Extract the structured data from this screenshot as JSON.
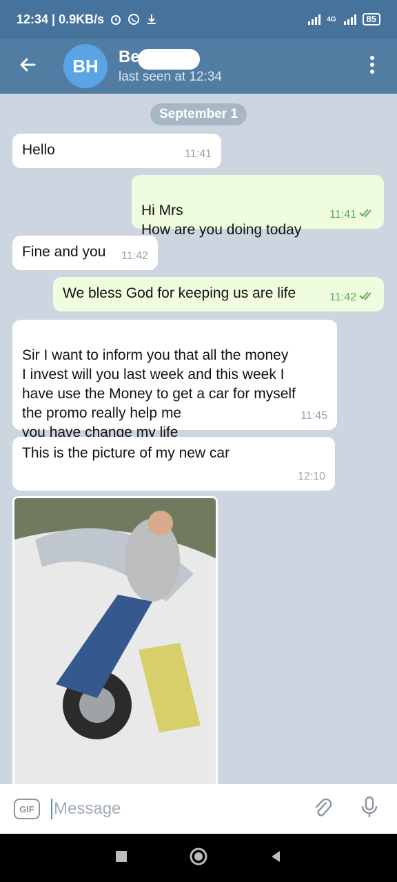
{
  "status_bar": {
    "time_speed": "12:34 | 0.9KB/s",
    "network": "4G",
    "battery": "85"
  },
  "header": {
    "avatar_initials": "BH",
    "contact_name": "Be",
    "last_seen": "last seen at 12:34"
  },
  "chat": {
    "date_label": "September 1",
    "messages": [
      {
        "text": "Hello",
        "time": "11:41"
      },
      {
        "text": "Hi Mrs\nHow are you doing today",
        "time": "11:41"
      },
      {
        "text": "Fine and you",
        "time": "11:42"
      },
      {
        "text": "We bless God for keeping us are life",
        "time": "11:42"
      },
      {
        "text": "Sir I want to inform you that all the money\nI invest will you last week and this week I\nhave use the Money to get a car for myself\nthe promo really help me\nyou have change my life",
        "time": "11:45"
      },
      {
        "text": "This is the picture of my new car",
        "time": "12:10"
      }
    ]
  },
  "input": {
    "gif_label": "GIF",
    "placeholder": "Message"
  },
  "colors": {
    "header": "#517da2",
    "status_bar": "#46739c",
    "outgoing_bubble": "#effdde",
    "incoming_bubble": "#ffffff",
    "chat_background": "#cdd6e0"
  },
  "icons": [
    "back-arrow-icon",
    "more-vert-icon",
    "double-check-icon",
    "paperclip-icon",
    "microphone-icon",
    "nav-square-icon",
    "nav-circle-icon",
    "nav-back-triangle-icon"
  ]
}
